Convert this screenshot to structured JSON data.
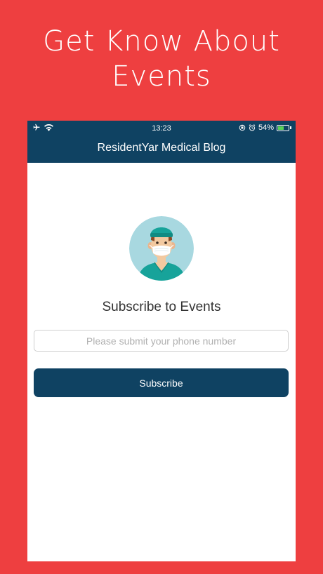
{
  "banner": {
    "line1": "Get Know About",
    "line2": "Events"
  },
  "status_bar": {
    "time": "13:23",
    "battery": "54%",
    "battery_level": 0.54,
    "icons": [
      "airplane-icon",
      "wifi-icon",
      "rotation-lock-icon",
      "alarm-icon",
      "battery-charging-icon"
    ]
  },
  "app": {
    "title": "ResidentYar Medical Blog"
  },
  "subscribe": {
    "heading": "Subscribe to Events",
    "phone_placeholder": "Please submit your phone number",
    "phone_value": "",
    "button_label": "Subscribe"
  },
  "colors": {
    "background": "#ee3f40",
    "app_bar": "#0f4262",
    "button": "#0f4262",
    "avatar_bg": "#a8d8e0",
    "scrubs": "#17a39a"
  }
}
